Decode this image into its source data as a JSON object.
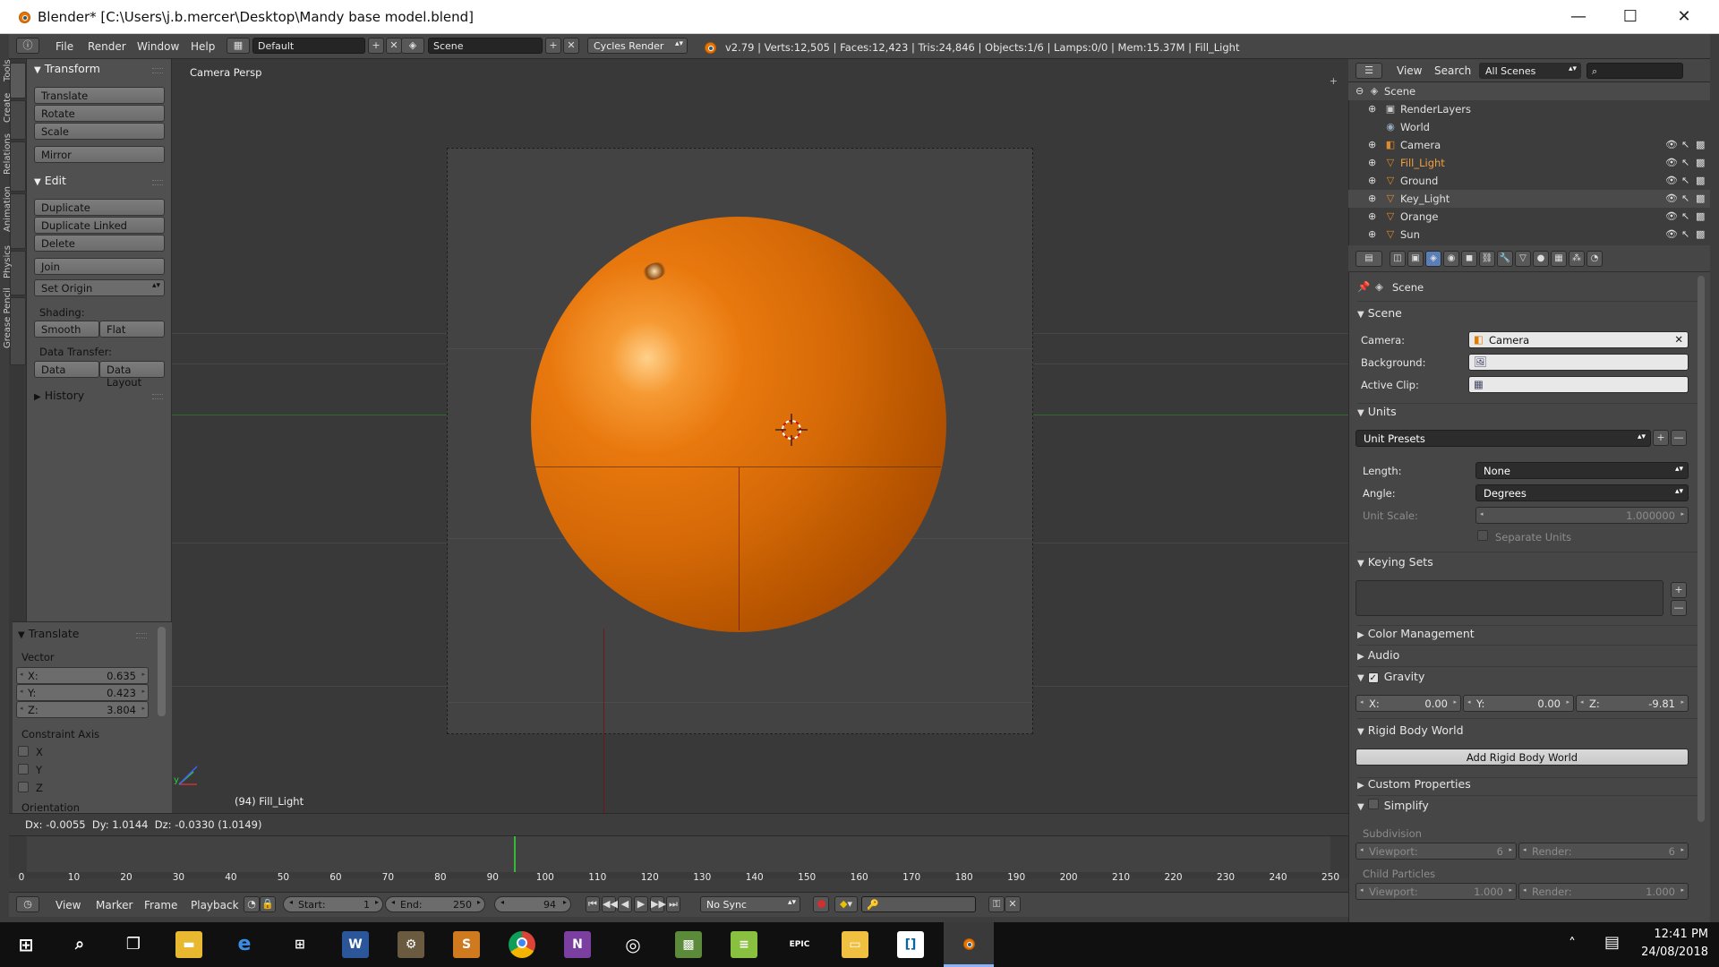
{
  "window": {
    "title": "Blender* [C:\\Users\\j.b.mercer\\Desktop\\Mandy base model.blend]",
    "controls": [
      "—",
      "☐",
      "✕"
    ]
  },
  "info_header": {
    "menus": [
      "File",
      "Render",
      "Window",
      "Help"
    ],
    "layout": "Default",
    "scene": "Scene",
    "render_engine": "Cycles Render",
    "stats": "v2.79 | Verts:12,505 | Faces:12,423 | Tris:24,846 | Objects:1/6 | Lamps:0/0 | Mem:15.37M | Fill_Light"
  },
  "left_tabs": [
    "Tools",
    "Create",
    "Relations",
    "Animation",
    "Physics",
    "Grease Pencil"
  ],
  "tool_shelf": {
    "transform_header": "Transform",
    "transform_buttons": [
      "Translate",
      "Rotate",
      "Scale"
    ],
    "mirror": "Mirror",
    "edit_header": "Edit",
    "edit_buttons": [
      "Duplicate",
      "Duplicate Linked",
      "Delete"
    ],
    "join": "Join",
    "set_origin": "Set Origin",
    "shading_label": "Shading:",
    "smooth": "Smooth",
    "flat": "Flat",
    "data_transfer_label": "Data Transfer:",
    "data": "Data",
    "data_layout": "Data Layout",
    "history_header": "History"
  },
  "operator_panel": {
    "header": "Translate",
    "vector_label": "Vector",
    "x_label": "X:",
    "x": "0.635",
    "y_label": "Y:",
    "y": "0.423",
    "z_label": "Z:",
    "z": "3.804",
    "constraint_label": "Constraint Axis",
    "axes": [
      "X",
      "Y",
      "Z"
    ],
    "orientation_label": "Orientation"
  },
  "viewport": {
    "view_name": "Camera Persp",
    "active_object": "(94) Fill_Light",
    "axis_x": "x",
    "axis_y": "y"
  },
  "status_line": "Dx: -0.0055  Dy: 1.0144  Dz: -0.0330 (1.0149)",
  "timeline": {
    "ticks": [
      "0",
      "10",
      "20",
      "30",
      "40",
      "50",
      "60",
      "70",
      "80",
      "90",
      "100",
      "110",
      "120",
      "130",
      "140",
      "150",
      "160",
      "170",
      "180",
      "190",
      "200",
      "210",
      "220",
      "230",
      "240",
      "250"
    ],
    "current_frame_value": 94,
    "frame_range": [
      0,
      250
    ],
    "menus": [
      "View",
      "Marker",
      "Frame",
      "Playback"
    ],
    "start_label": "Start:",
    "start": "1",
    "end_label": "End:",
    "end": "250",
    "current_frame": "94",
    "sync": "No Sync"
  },
  "outliner": {
    "menus": [
      "View",
      "Search"
    ],
    "filter": "All Scenes",
    "rows": [
      {
        "name": "Scene",
        "icon": "scene-icon"
      },
      {
        "name": "RenderLayers",
        "icon": "renderlayers-icon"
      },
      {
        "name": "World",
        "icon": "world-icon"
      },
      {
        "name": "Camera",
        "icon": "camera-icon"
      },
      {
        "name": "Fill_Light",
        "icon": "mesh-icon"
      },
      {
        "name": "Ground",
        "icon": "mesh-icon"
      },
      {
        "name": "Key_Light",
        "icon": "mesh-icon"
      },
      {
        "name": "Orange",
        "icon": "mesh-icon"
      },
      {
        "name": "Sun",
        "icon": "mesh-icon"
      }
    ]
  },
  "properties": {
    "context": "Scene",
    "scene_header": "Scene",
    "camera_label": "Camera:",
    "camera": "Camera",
    "background_label": "Background:",
    "active_clip_label": "Active Clip:",
    "units_header": "Units",
    "unit_presets": "Unit Presets",
    "length_label": "Length:",
    "length": "None",
    "angle_label": "Angle:",
    "angle": "Degrees",
    "unit_scale_label": "Unit Scale:",
    "unit_scale": "1.000000",
    "separate_units": "Separate Units",
    "keying_sets_header": "Keying Sets",
    "color_management_header": "Color Management",
    "audio_header": "Audio",
    "gravity_header": "Gravity",
    "gravity_x_label": "X:",
    "gravity_x": "0.00",
    "gravity_y_label": "Y:",
    "gravity_y": "0.00",
    "gravity_z_label": "Z:",
    "gravity_z": "-9.81",
    "rigid_body_header": "Rigid Body World",
    "add_rigid_body": "Add Rigid Body World",
    "custom_props_header": "Custom Properties",
    "simplify_header": "Simplify",
    "subdivision_label": "Subdivision",
    "viewport_label": "Viewport:",
    "subdiv_viewport": "6",
    "render_label": "Render:",
    "subdiv_render": "6",
    "child_particles_label": "Child Particles",
    "child_viewport": "1.000",
    "child_render": "1.000"
  },
  "taskbar": {
    "time": "12:41 PM",
    "date": "24/08/2018"
  },
  "colors": {
    "orange": "#e8780e",
    "blender_bg": "#3d3d3d",
    "timeline_cursor": "#38b838"
  }
}
